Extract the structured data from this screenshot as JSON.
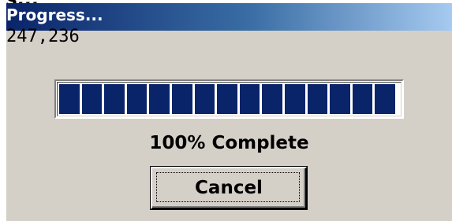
{
  "window": {
    "cutoff_title": "s...",
    "title": "Progress...",
    "count": "247,236"
  },
  "progress": {
    "percent": 100,
    "segments": 15,
    "label": "100% Complete",
    "bar_color": "#0a246a"
  },
  "buttons": {
    "cancel_label": "Cancel"
  },
  "colors": {
    "dialog_bg": "#d4d0c8",
    "title_gradient_start": "#0a246a",
    "title_gradient_end": "#a6caf0",
    "title_text": "#ffffff"
  }
}
